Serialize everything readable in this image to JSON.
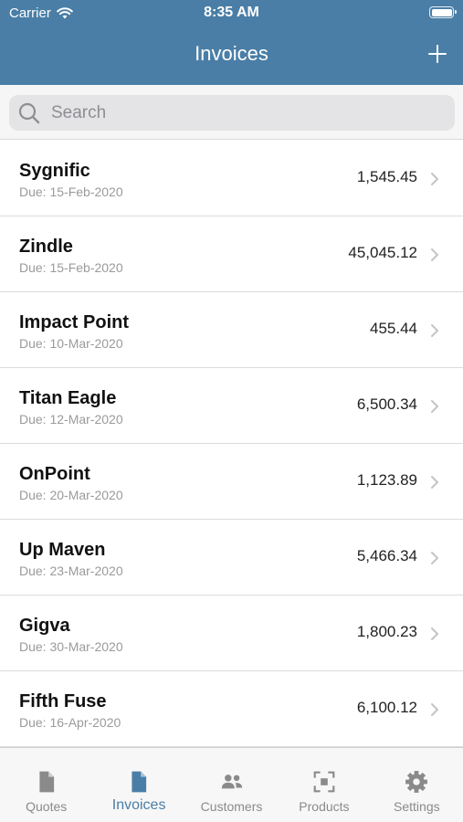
{
  "status_bar": {
    "carrier": "Carrier",
    "time": "8:35 AM"
  },
  "nav": {
    "title": "Invoices",
    "add_icon": "plus-icon"
  },
  "search": {
    "placeholder": "Search",
    "value": ""
  },
  "invoices": [
    {
      "name": "Sygnific",
      "due": "Due: 15-Feb-2020",
      "amount": "1,545.45"
    },
    {
      "name": "Zindle",
      "due": "Due: 15-Feb-2020",
      "amount": "45,045.12"
    },
    {
      "name": "Impact Point",
      "due": "Due: 10-Mar-2020",
      "amount": "455.44"
    },
    {
      "name": "Titan Eagle",
      "due": "Due: 12-Mar-2020",
      "amount": "6,500.34"
    },
    {
      "name": "OnPoint",
      "due": "Due: 20-Mar-2020",
      "amount": "1,123.89"
    },
    {
      "name": "Up Maven",
      "due": "Due: 23-Mar-2020",
      "amount": "5,466.34"
    },
    {
      "name": "Gigva",
      "due": "Due: 30-Mar-2020",
      "amount": "1,800.23"
    },
    {
      "name": "Fifth Fuse",
      "due": "Due: 16-Apr-2020",
      "amount": "6,100.12"
    }
  ],
  "tabs": [
    {
      "label": "Quotes",
      "icon": "document-icon",
      "active": false
    },
    {
      "label": "Invoices",
      "icon": "document-icon",
      "active": true
    },
    {
      "label": "Customers",
      "icon": "people-icon",
      "active": false
    },
    {
      "label": "Products",
      "icon": "scan-icon",
      "active": false
    },
    {
      "label": "Settings",
      "icon": "gear-icon",
      "active": false
    }
  ],
  "colors": {
    "brand": "#4a7ea6",
    "inactive_tab": "#8a8a8a",
    "due_text": "#9a9a9a"
  }
}
